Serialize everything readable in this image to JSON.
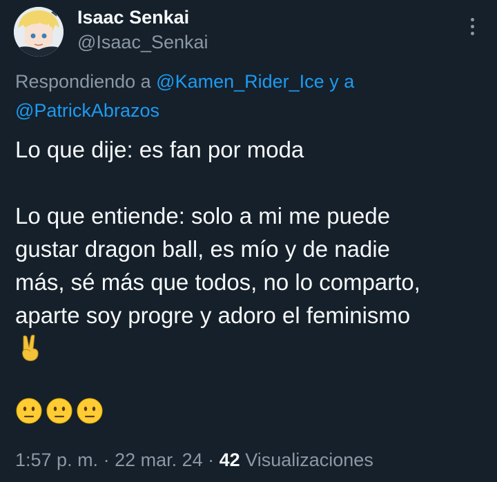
{
  "author": {
    "display_name": "Isaac Senkai",
    "handle": "@Isaac_Senkai",
    "avatar_icon": "anime-avatar"
  },
  "reply": {
    "prefix": "Respondiendo a ",
    "mention_1": "@Kamen_Rider_Ice",
    "connector": " y a",
    "mention_2": "@PatrickAbrazos"
  },
  "body": {
    "line_1": "Lo que dije: es fan por moda",
    "line_2": "Lo que entiende: solo a mi me puede",
    "line_3": "gustar dragon ball, es mío y de nadie",
    "line_4": "más, sé más que todos, no lo comparto,",
    "line_5": "aparte soy progre y adoro el feminismo",
    "emoji_1": "victory-hand",
    "emoji_row": [
      "neutral-face",
      "neutral-face",
      "neutral-face"
    ]
  },
  "meta": {
    "time": "1:57 p. m.",
    "separator": " · ",
    "date": "22 mar. 24",
    "views_count": "42",
    "views_label": " Visualizaciones"
  },
  "colors": {
    "background": "#15202b",
    "text": "#f7f9f9",
    "secondary": "#8b98a5",
    "link": "#1d9bf0"
  }
}
